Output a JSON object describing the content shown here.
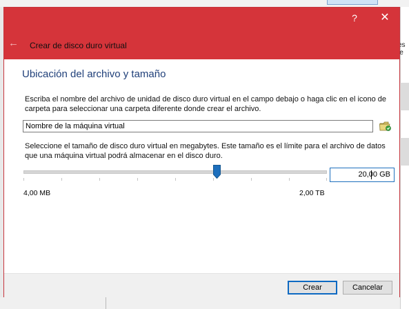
{
  "window": {
    "help_label": "?",
    "close_label": "✕"
  },
  "header": {
    "back_icon": "arrow-left",
    "title": "Crear de disco duro virtual"
  },
  "main": {
    "section_title": "Ubicación del archivo y tamaño",
    "location_instructions": "Escriba el nombre del archivo de unidad de disco duro virtual en el campo debajo o haga clic en el icono de carpeta para seleccionar una carpeta diferente donde crear el archivo.",
    "file_name_value": "Nombre de la máquina virtual",
    "folder_icon": "folder-green-icon",
    "size_instructions": "Seleccione el tamaño de disco duro virtual en megabytes. Este tamaño es el límite para el archivo de datos que una máquina virtual podrá almacenar en el disco duro.",
    "slider": {
      "min_label": "4,00 MB",
      "max_label": "2,00 TB",
      "position_fraction": 0.64
    },
    "size_value": "20,00 GB"
  },
  "footer": {
    "create_label": "Crear",
    "cancel_label": "Cancelar"
  },
  "colors": {
    "titlebar": "#d5343a",
    "section_title": "#1f3f79",
    "accent": "#1d6fbd"
  },
  "background": {
    "right_edge_text": "es\nle"
  }
}
